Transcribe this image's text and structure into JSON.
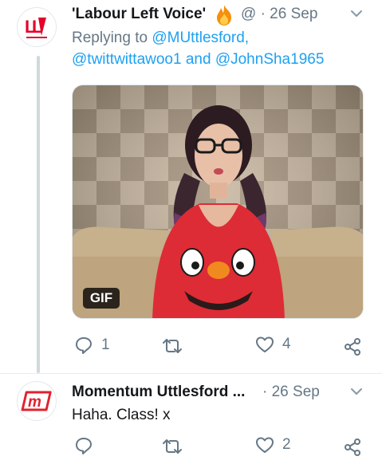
{
  "tweet1": {
    "display_name": "'Labour Left Voice'",
    "name_emoji": "fire-emoji",
    "handle_date": "@ · 26 Sep",
    "replying_to_prefix": "Replying to ",
    "replying_to_user1": "@MUttlesford,",
    "replying_to_user2": "@twittwittawoo1",
    "replying_and": " and ",
    "replying_to_user3": "@JohnSha1965",
    "media_badge": "GIF",
    "reply_count": "1",
    "retweet_count": "",
    "like_count": "4"
  },
  "tweet2": {
    "display_name": "Momentum Uttlesford ...",
    "date": "· 26 Sep",
    "text": "Haha. Class! x",
    "reply_count": "",
    "retweet_count": "",
    "like_count": "2"
  },
  "colors": {
    "link": "#1da1f2",
    "muted": "#657786",
    "text": "#14171a",
    "labour_red": "#e4002b",
    "momentum_red": "#e3202f",
    "thread_line": "#cfd9de"
  },
  "icons": [
    "chevron-down-icon",
    "reply-icon",
    "retweet-icon",
    "like-icon",
    "share-icon"
  ]
}
